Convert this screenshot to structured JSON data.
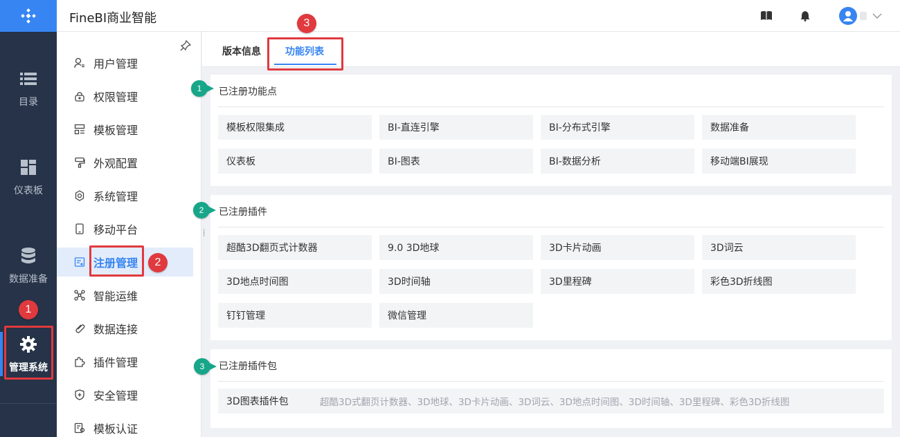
{
  "app": {
    "title": "FineBI商业智能"
  },
  "rail": {
    "items": [
      {
        "label": "目录",
        "icon": "list-icon"
      },
      {
        "label": "仪表板",
        "icon": "dashboard-icon"
      },
      {
        "label": "数据准备",
        "icon": "database-icon"
      },
      {
        "label": "管理系统",
        "icon": "gear-icon"
      }
    ]
  },
  "subnav": {
    "items": [
      {
        "label": "用户管理",
        "icon": "user-icon"
      },
      {
        "label": "权限管理",
        "icon": "lock-icon"
      },
      {
        "label": "模板管理",
        "icon": "template-icon"
      },
      {
        "label": "外观配置",
        "icon": "brush-icon"
      },
      {
        "label": "系统管理",
        "icon": "settings-icon"
      },
      {
        "label": "移动平台",
        "icon": "mobile-icon"
      },
      {
        "label": "注册管理",
        "icon": "register-icon"
      },
      {
        "label": "智能运维",
        "icon": "ops-icon"
      },
      {
        "label": "数据连接",
        "icon": "link-icon"
      },
      {
        "label": "插件管理",
        "icon": "plugin-icon"
      },
      {
        "label": "安全管理",
        "icon": "shield-icon"
      },
      {
        "label": "模板认证",
        "icon": "certificate-icon"
      }
    ],
    "active": "注册管理"
  },
  "tabs": [
    {
      "label": "版本信息"
    },
    {
      "label": "功能列表"
    }
  ],
  "sections": {
    "features": {
      "title": "已注册功能点",
      "items": [
        "模板权限集成",
        "BI-直连引擎",
        "BI-分布式引擎",
        "数据准备",
        "仪表板",
        "BI-图表",
        "BI-数据分析",
        "移动端BI展现"
      ]
    },
    "plugins": {
      "title": "已注册插件",
      "items": [
        "超酷3D翻页式计数器",
        "9.0 3D地球",
        "3D卡片动画",
        "3D词云",
        "3D地点时间图",
        "3D时间轴",
        "3D里程碑",
        "彩色3D折线图",
        "钉钉管理",
        "微信管理"
      ]
    },
    "packages": {
      "title": "已注册插件包",
      "name": "3D图表插件包",
      "content": "超酷3D式翻页计数器、3D地球、3D卡片动画、3D词云、3D地点时间图、3D时间轴、3D里程碑、彩色3D折线图"
    }
  },
  "annotations": {
    "red": [
      "1",
      "2",
      "3"
    ],
    "green": [
      "1",
      "2",
      "3"
    ]
  },
  "colors": {
    "accent": "#3685f2",
    "rail": "#263348",
    "annotation_red": "#e0393e",
    "annotation_green": "#17a689"
  }
}
